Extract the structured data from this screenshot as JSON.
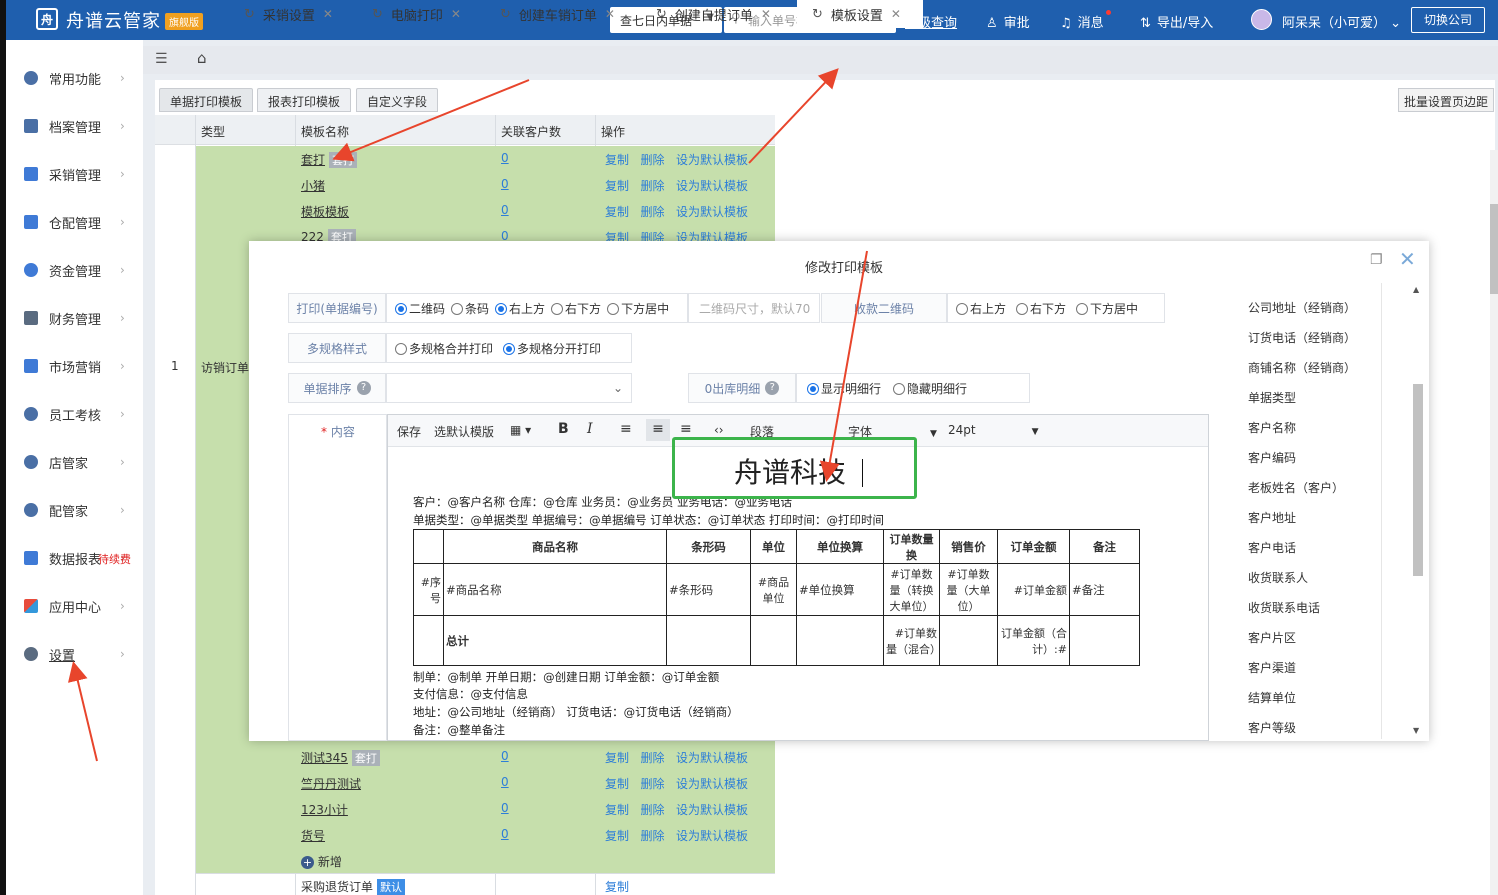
{
  "topbar": {
    "logo_glyph": "舟",
    "brand": "舟谱云管家",
    "edition": "旗舰版",
    "range_select": "查七日内单据",
    "search_placeholder": "输入单号模糊查询",
    "links": [
      "高级查询",
      "审批",
      "消息",
      "导出/导入"
    ],
    "user": "阿呆呆（小可爱）",
    "switch_company": "切换公司"
  },
  "sidebar": {
    "items": [
      "常用功能",
      "档案管理",
      "采销管理",
      "仓配管理",
      "资金管理",
      "财务管理",
      "市场营销",
      "员工考核",
      "店管家",
      "配管家",
      "数据报表",
      "应用中心",
      "设置"
    ],
    "pending_badge": "待续费"
  },
  "tabs": [
    "采销设置",
    "电脑打印",
    "创建车销订单",
    "创建自提订单",
    "模板设置"
  ],
  "subtabs": [
    "单据打印模板",
    "报表打印模板",
    "自定义字段"
  ],
  "batch_button": "批量设置页边距",
  "grid": {
    "headers": [
      "类型",
      "模板名称",
      "关联客户数",
      "操作"
    ],
    "row_index": "1",
    "row_type": "访销订单",
    "ops": [
      "复制",
      "删除",
      "设为默认模板"
    ],
    "top_rows": [
      {
        "name": "套打",
        "tag": "套打",
        "count": "0"
      },
      {
        "name": "小猪",
        "tag": "",
        "count": "0"
      },
      {
        "name": "模板模板",
        "tag": "",
        "count": "0"
      },
      {
        "name": "222",
        "tag": "套打",
        "count": "0"
      }
    ],
    "bottom_rows": [
      {
        "name": "测试345",
        "tag": "套打",
        "count": "0"
      },
      {
        "name": "竺丹丹测试",
        "tag": "",
        "count": "0"
      },
      {
        "name": "123小计",
        "tag": "",
        "count": "0"
      },
      {
        "name": "货号",
        "tag": "",
        "count": "0"
      }
    ],
    "add_new": "新增",
    "next_type": "采购退货订单",
    "next_tag": "默认",
    "next_op": "复制"
  },
  "modal": {
    "title": "修改打印模板",
    "print_label": "打印(单据编号)",
    "print_opts": [
      "二维码",
      "条码",
      "右上方",
      "右下方",
      "下方居中"
    ],
    "qr_size_placeholder": "二维码尺寸，默认70",
    "pay_qr_label": "收款二维码",
    "pay_opts": [
      "右上方",
      "右下方",
      "下方居中"
    ],
    "multi_label": "多规格样式",
    "multi_opts": [
      "多规格合并打印",
      "多规格分开打印"
    ],
    "sort_label": "单据排序",
    "zero_label": "0出库明细",
    "zero_opts": [
      "显示明细行",
      "隐藏明细行"
    ],
    "content_label": "内容",
    "toolbar": {
      "save": "保存",
      "choose_default": "选默认模版",
      "paragraph": "段落",
      "font": "字体",
      "size": "24pt"
    },
    "doc": {
      "title": "舟谱科技",
      "line1": "客户：@客户名称  仓库：@仓库  业务员：@业务员  业务电话：@业务电话",
      "line2": "单据类型：@单据类型  单据编号：@单据编号  订单状态：@订单状态  打印时间：@打印时间",
      "table_header": [
        "",
        "商品名称",
        "条形码",
        "单位",
        "单位换算",
        "订单数量换",
        "销售价",
        "订单金额",
        "备注"
      ],
      "table_row": [
        "#序号",
        "#商品名称",
        "#条形码",
        "#商品单位",
        "#单位换算",
        "#订单数量（转换大单位）",
        "#订单数量（大单位）",
        "#订单金额",
        "#备注"
      ],
      "table_total": [
        "",
        "总计",
        "",
        "",
        "",
        "#订单数量（混合）",
        "",
        "订单金额（合计）:#",
        ""
      ],
      "footer1": "制单：@制单     开单日期：@创建日期  订单金额：@订单金额",
      "footer2": "支付信息：@支付信息",
      "footer3": "地址：@公司地址（经销商）    订货电话：@订货电话（经销商）",
      "footer4": "备注：@整单备注"
    },
    "fields": [
      "公司地址（经销商）",
      "订货电话（经销商）",
      "商铺名称（经销商）",
      "单据类型",
      "客户名称",
      "客户编码",
      "老板姓名（客户）",
      "客户地址",
      "客户电话",
      "收货联系人",
      "收货联系电话",
      "客户片区",
      "客户渠道",
      "结算单位",
      "客户等级"
    ]
  },
  "colors": {
    "topbar": "#1f5fae",
    "green_row": "#c6dfac",
    "link": "#2d7ed8",
    "annotation": "#e8452c",
    "highlight_box": "#3cb44b"
  }
}
